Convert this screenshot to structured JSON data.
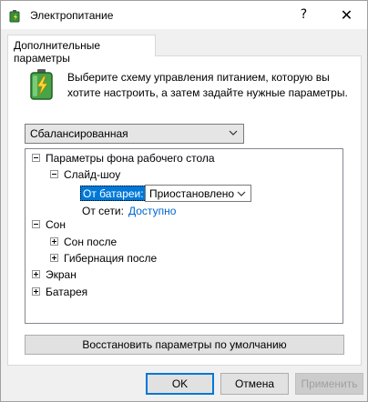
{
  "window": {
    "title": "Электропитание",
    "help_label": "?",
    "close_label": "✕"
  },
  "tab": {
    "label": "Дополнительные параметры"
  },
  "description": "Выберите схему управления питанием, которую вы хотите настроить, а затем задайте нужные параметры.",
  "scheme_select": {
    "value": "Сбалансированная"
  },
  "tree": {
    "items": [
      {
        "label": "Параметры фона рабочего стола",
        "expanded": true
      },
      {
        "label": "Слайд-шоу",
        "expanded": true
      },
      {
        "label": "Сон",
        "expanded": true
      },
      {
        "label": "Сон после",
        "expanded": false
      },
      {
        "label": "Гибернация после",
        "expanded": false
      },
      {
        "label": "Экран",
        "expanded": false
      },
      {
        "label": "Батарея",
        "expanded": false
      }
    ],
    "on_battery": {
      "label": "От батареи:",
      "value": "Приостановлено"
    },
    "on_ac": {
      "label": "От сети:",
      "value": "Доступно"
    }
  },
  "restore_button": "Восстановить параметры по умолчанию",
  "buttons": {
    "ok": "OK",
    "cancel": "Отмена",
    "apply": "Применить"
  },
  "colors": {
    "accent": "#0078d7",
    "link": "#0066cc"
  },
  "icons": [
    "power-options-icon",
    "battery-icon",
    "chevron-down-icon",
    "collapse-icon",
    "expand-icon",
    "close-icon",
    "help-icon"
  ]
}
